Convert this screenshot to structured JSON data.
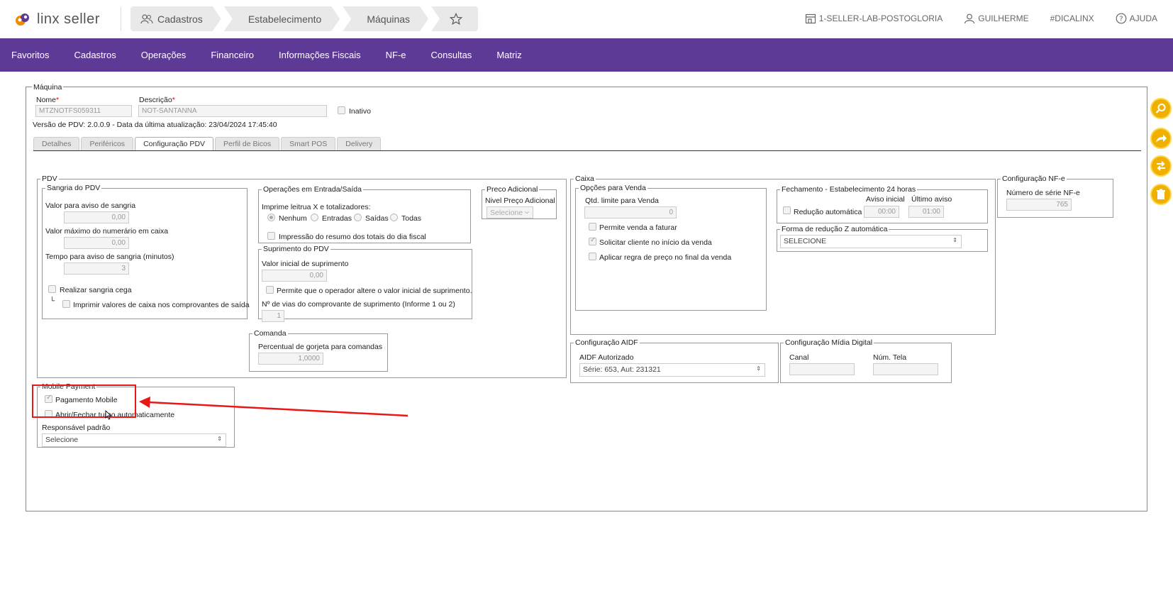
{
  "header": {
    "logo_text": "linx seller",
    "breadcrumb": [
      "Cadastros",
      "Estabelecimento",
      "Máquinas"
    ],
    "store": "1-SELLER-LAB-POSTOGLORIA",
    "user": "GUILHERME",
    "hashtag": "#DICALINX",
    "help": "AJUDA"
  },
  "nav": [
    "Favoritos",
    "Cadastros",
    "Operações",
    "Financeiro",
    "Informações Fiscais",
    "NF-e",
    "Consultas",
    "Matriz"
  ],
  "maquina": {
    "legend": "Máquina",
    "nome_label": "Nome",
    "nome_value": "MTZNOTFS059311",
    "descricao_label": "Descrição",
    "descricao_value": "NOT-SANTANNA",
    "inativo_label": "Inativo",
    "versao": "Versão de PDV: 2.0.0.9 - Data da última atualização: 23/04/2024 17:45:40"
  },
  "tabs": [
    "Detalhes",
    "Periféricos",
    "Configuração PDV",
    "Perfil de Bicos",
    "Smart POS",
    "Delivery"
  ],
  "pdv": {
    "legend": "PDV",
    "sangria": {
      "legend": "Sangria do PDV",
      "aviso_label": "Valor para aviso de sangria",
      "aviso_value": "0,00",
      "maximo_label": "Valor máximo do numerário em caixa",
      "maximo_value": "0,00",
      "tempo_label": "Tempo para aviso de sangria (minutos)",
      "tempo_value": "3",
      "cega_label": "Realizar sangria cega",
      "imprimir_label": "Imprimir valores de caixa nos comprovantes de saída"
    },
    "operacoes": {
      "legend": "Operações em Entrada/Saída",
      "imprime_label": "Imprime leitrua X e totalizadores:",
      "options": [
        "Nenhum",
        "Entradas",
        "Saídas",
        "Todas"
      ],
      "resumo_label": "Impressão do resumo dos totais do dia fiscal"
    },
    "suprimento": {
      "legend": "Suprimento do PDV",
      "valor_label": "Valor inicial de suprimento",
      "valor_value": "0,00",
      "permite_label": "Permite que o operador altere o valor inicial de suprimento.",
      "vias_label": "Nº de vias do comprovante de suprimento (Informe 1 ou 2)",
      "vias_value": "1"
    },
    "preco": {
      "legend": "Preco Adicional",
      "nivel_label": "Nivel Preço Adicional",
      "nivel_value": "Selecione"
    },
    "comanda": {
      "legend": "Comanda",
      "gorjeta_label": "Percentual de gorjeta para comandas",
      "gorjeta_value": "1,0000"
    }
  },
  "caixa": {
    "legend": "Caixa",
    "opcoes": {
      "legend": "Opções para Venda",
      "qtd_label": "Qtd. limite para Venda",
      "qtd_value": "0",
      "faturar_label": "Permite venda a faturar",
      "solicitar_label": "Solicitar cliente no início da venda",
      "aplicar_label": "Aplicar regra de preço no final da venda"
    },
    "fechamento": {
      "legend": "Fechamento - Estabelecimento 24 horas",
      "reducao_label": "Redução automática",
      "aviso_inicial_label": "Aviso inicial",
      "aviso_inicial_value": "00:00",
      "ultimo_aviso_label": "Último aviso",
      "ultimo_aviso_value": "01:00"
    },
    "forma": {
      "legend": "Forma de redução Z automática",
      "value": "SELECIONE"
    }
  },
  "nfe": {
    "legend": "Configuração NF-e",
    "serie_label": "Número de série NF-e",
    "serie_value": "765"
  },
  "aidf": {
    "legend": "Configuração AIDF",
    "label": "AIDF Autorizado",
    "value": "Série: 653, Aut: 231321"
  },
  "midia": {
    "legend": "Configuração Mídia Digital",
    "canal_label": "Canal",
    "tela_label": "Núm. Tela"
  },
  "mobile": {
    "legend": "Mobile Payment",
    "pagamento_label": "Pagamento Mobile",
    "turno_label": "Abrir/Fechar turno automaticamente",
    "responsavel_label": "Responsável padrão",
    "responsavel_value": "Selecione"
  },
  "colors": {
    "nav": "#5c3a96",
    "fab": "#f0b000",
    "annotation": "#e81818"
  }
}
